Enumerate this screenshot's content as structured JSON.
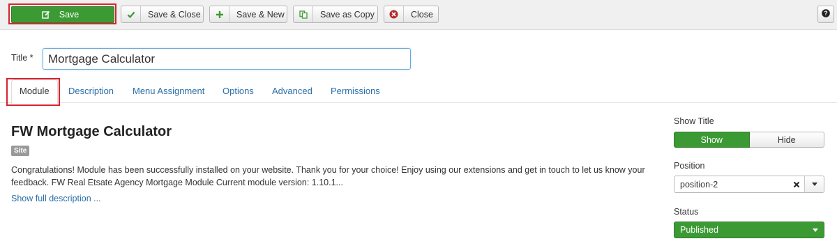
{
  "toolbar": {
    "save": {
      "label": "Save",
      "icon": "edit-icon"
    },
    "save_close": {
      "label": "Save & Close",
      "icon": "check-icon"
    },
    "save_new": {
      "label": "Save & New",
      "icon": "plus-icon"
    },
    "save_copy": {
      "label": "Save as Copy",
      "icon": "copy-icon"
    },
    "close": {
      "label": "Close",
      "icon": "cancel-circle-icon"
    },
    "help": {
      "icon": "help-icon"
    }
  },
  "form": {
    "title_label": "Title *",
    "title_value": "Mortgage Calculator"
  },
  "tabs": [
    {
      "label": "Module",
      "active": true
    },
    {
      "label": "Description"
    },
    {
      "label": "Menu Assignment"
    },
    {
      "label": "Options"
    },
    {
      "label": "Advanced"
    },
    {
      "label": "Permissions"
    }
  ],
  "module": {
    "heading": "FW Mortgage Calculator",
    "badge": "Site",
    "description": "Congratulations! Module has been successfully installed on your website. Thank you for your choice! Enjoy using our extensions and get in touch to let us know your feedback. FW Real Etsate Agency Mortgage Module Current module version: 1.10.1...",
    "show_full": "Show full description ..."
  },
  "sidebar": {
    "show_title_label": "Show Title",
    "show_label": "Show",
    "hide_label": "Hide",
    "position_label": "Position",
    "position_value": "position-2",
    "status_label": "Status",
    "status_value": "Published"
  },
  "colors": {
    "primary_green": "#3c9a34",
    "link_blue": "#2a6ea8",
    "highlight_red": "#d9232f"
  }
}
